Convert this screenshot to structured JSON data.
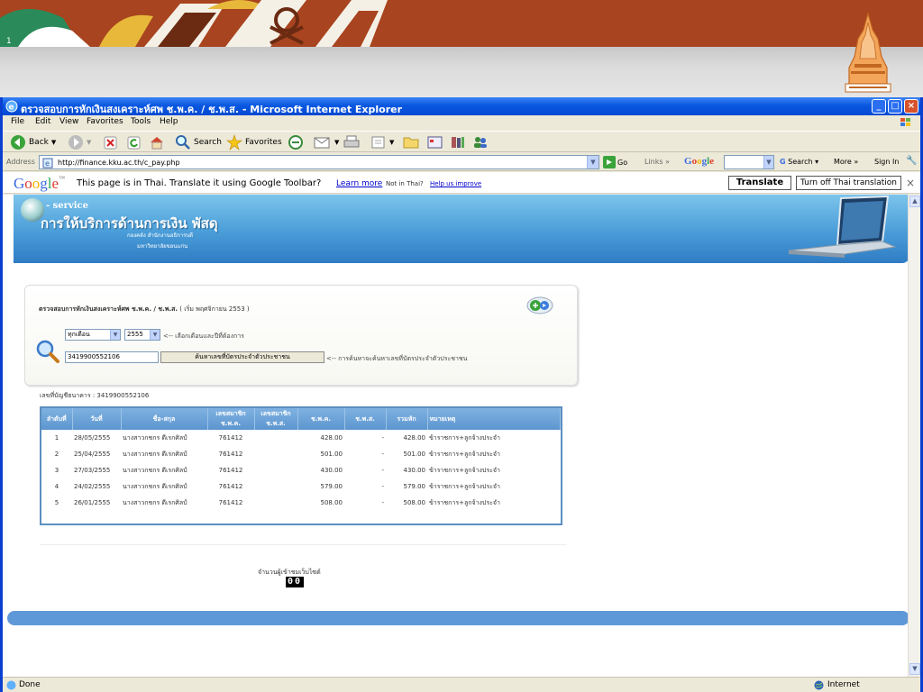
{
  "slide": {
    "number": "1"
  },
  "window": {
    "title": "ตรวจสอบการหักเงินสงเคราะห์ศพ ช.พ.ค. / ช.พ.ส. - Microsoft Internet Explorer"
  },
  "menu": [
    "File",
    "Edit",
    "View",
    "Favorites",
    "Tools",
    "Help"
  ],
  "toolbar": {
    "back": "Back",
    "search": "Search",
    "favorites": "Favorites"
  },
  "address": {
    "label": "Address",
    "url": "http://finance.kku.ac.th/c_pay.php",
    "go": "Go",
    "links": "Links",
    "google": "Google",
    "search": "Search",
    "more": "More »",
    "sign_in": "Sign In"
  },
  "translate_bar": {
    "logo": "Google",
    "message": "This page is in Thai.  Translate it using Google Toolbar?",
    "learn_more": "Learn more",
    "not_thai": "Not in Thai?",
    "help": "Help us improve",
    "translate": "Translate",
    "turn_off": "Turn off Thai translation",
    "close": "×"
  },
  "banner": {
    "eservice": "- service",
    "title": "การให้บริการด้านการเงิน พัสดุ",
    "sub1": "กองคลัง สำนักงานอธิการบดี",
    "sub2": "มหาวิทยาลัยขอนแก่น"
  },
  "search_panel": {
    "title_bold": "ตรวจสอบการหักเงินสงเคราะห์ศพ ช.พ.ค. / ช.พ.ส.",
    "title_rest": " ( เริ่ม พฤศจิกายน 2553 )",
    "month": "ทุกเดือน",
    "year": "2555",
    "month_hint": "<-- เลือกเดือนและปีที่ต้องการ",
    "id_value": "3419900552106",
    "search_button": "ค้นหาเลขที่บัตรประจำตัวประชาชน",
    "search_hint": "<-- การค้นหาจะค้นหาเลขที่บัตรประจำตัวประชาชน"
  },
  "account_line": "เลขที่บัญชีธนาคาร : 3419900552106",
  "table": {
    "headers": [
      "ลำดับที่",
      "วันที่",
      "ชื่อ-สกุล",
      "เลขสมาชิก ช.พ.ค.",
      "เลขสมาชิก ช.พ.ส.",
      "ช.พ.ค.",
      "ช.พ.ส.",
      "รวมหัก",
      "หมายเหตุ"
    ],
    "rows": [
      [
        "1",
        "28/05/2555",
        "นางสาวกชกร ดีเรกศิลป์",
        "761412",
        "",
        "428.00",
        "-",
        "428.00",
        "ข้าราชการ+ลูกจ้างประจำ"
      ],
      [
        "2",
        "25/04/2555",
        "นางสาวกชกร ดีเรกศิลป์",
        "761412",
        "",
        "501.00",
        "-",
        "501.00",
        "ข้าราชการ+ลูกจ้างประจำ"
      ],
      [
        "3",
        "27/03/2555",
        "นางสาวกชกร ดีเรกศิลป์",
        "761412",
        "",
        "430.00",
        "-",
        "430.00",
        "ข้าราชการ+ลูกจ้างประจำ"
      ],
      [
        "4",
        "24/02/2555",
        "นางสาวกชกร ดีเรกศิลป์",
        "761412",
        "",
        "579.00",
        "-",
        "579.00",
        "ข้าราชการ+ลูกจ้างประจำ"
      ],
      [
        "5",
        "26/01/2555",
        "นางสาวกชกร ดีเรกศิลป์",
        "761412",
        "",
        "508.00",
        "-",
        "508.00",
        "ข้าราชการ+ลูกจ้างประจำ"
      ]
    ]
  },
  "counter": {
    "label": "จำนวนผู้เข้าชมเว็บไซต์",
    "value": "00"
  },
  "status": {
    "done": "Done",
    "zone": "Internet"
  },
  "colors": {
    "title_bar": "#0a58e0",
    "banner": "#4a9dd8",
    "table_header": "#5c95cf",
    "slide_banner": "#a8441f"
  }
}
